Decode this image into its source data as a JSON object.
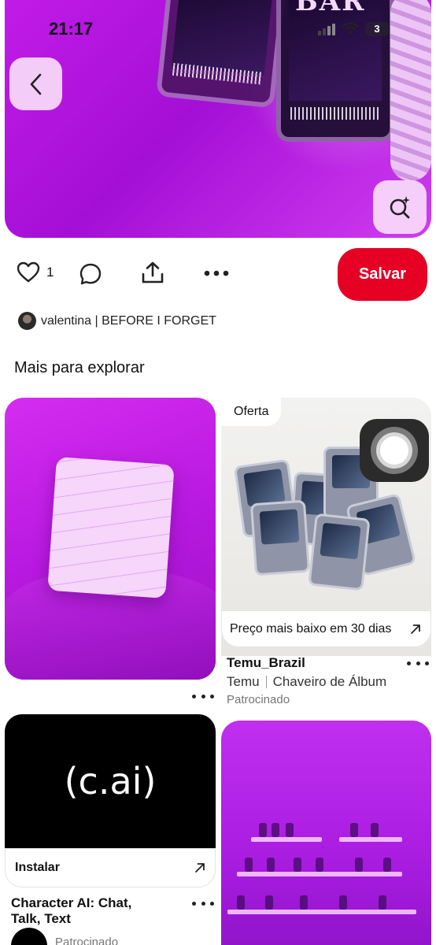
{
  "status_bar": {
    "time": "21:17",
    "battery": "3"
  },
  "pin": {
    "hero_art_text": "BAR",
    "like_count": "1",
    "save_label": "Salvar",
    "author": "valentina | BEFORE I FORGET"
  },
  "section": {
    "title": "Mais para explorar"
  },
  "cards": {
    "temu": {
      "badge": "Oferta",
      "cta": "Preço mais baixo em 30 dias",
      "title": "Temu_Brazil",
      "advertiser": "Temu",
      "product": "Chaveiro de Álbum",
      "sponsored": "Patrocinado"
    },
    "cai": {
      "logo": "(c.ai)",
      "cta": "Instalar",
      "title_line1": "Character AI: Chat,",
      "title_line2": "Talk, Text",
      "sponsored_cut": "Patrocinado"
    }
  },
  "colors": {
    "accent": "#e60023",
    "hero_purple": "#b819e0"
  },
  "icons": [
    "chevron-left-icon",
    "visual-search-icon",
    "heart-icon",
    "comment-icon",
    "share-icon",
    "more-icon",
    "arrow-up-right-icon"
  ]
}
